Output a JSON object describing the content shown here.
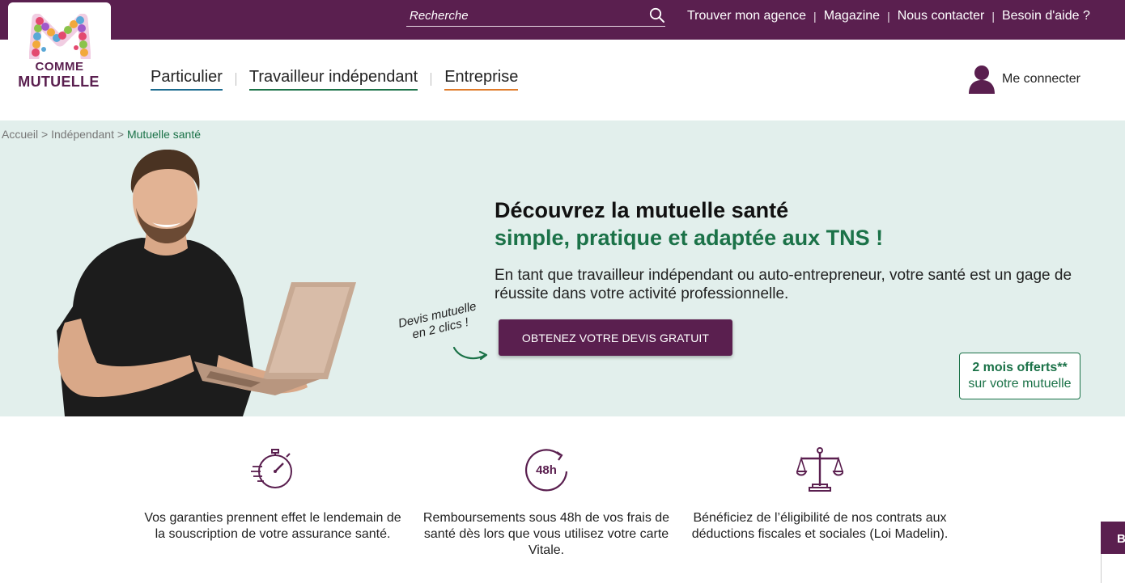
{
  "topbar": {
    "search_placeholder": "Recherche",
    "links": [
      "Trouver mon agence",
      "Magazine",
      "Nous contacter",
      "Besoin d'aide ?"
    ]
  },
  "logo": {
    "line1": "COMME",
    "line2": "MUTUELLE"
  },
  "nav": {
    "items": [
      {
        "label": "Particulier",
        "color": "#1a6a8e"
      },
      {
        "label": "Travailleur indépendant",
        "color": "#1b7248"
      },
      {
        "label": "Entreprise",
        "color": "#e07b2a"
      }
    ]
  },
  "account": {
    "label": "Me connecter"
  },
  "breadcrumb": {
    "items": [
      "Accueil",
      "Indépendant"
    ],
    "current": "Mutuelle santé",
    "separator": ">"
  },
  "hero": {
    "title_line1": "Découvrez la mutuelle santé",
    "title_line2": "simple, pratique et adaptée aux TNS !",
    "lead": "En tant que travailleur indépendant ou auto-entrepreneur, votre santé est un gage de réussite dans votre activité professionnelle.",
    "note_line1": "Devis mutuelle",
    "note_line2": "en 2 clics !",
    "cta": "OBTENEZ VOTRE DEVIS GRATUIT",
    "offer_bold": "2 mois offerts",
    "offer_mark": "**",
    "offer_text": "sur votre mutuelle"
  },
  "features": [
    {
      "icon": "stopwatch-icon",
      "text": "Vos garanties prennent effet le lendemain de la souscription de votre assurance santé."
    },
    {
      "icon": "48h-icon",
      "icon_text": "48h",
      "text": "Remboursements sous 48h de vos frais de santé dès lors que vous utilisez votre carte Vitale."
    },
    {
      "icon": "scales-icon",
      "text": "Bénéficiez de l’éligibilité de nos contrats aux déductions fiscales et sociales (Loi Madelin)."
    }
  ],
  "side_tab": {
    "label": "B"
  },
  "colors": {
    "primary": "#5a1f4f",
    "green": "#1b7248",
    "hero_bg": "#e2efec"
  }
}
